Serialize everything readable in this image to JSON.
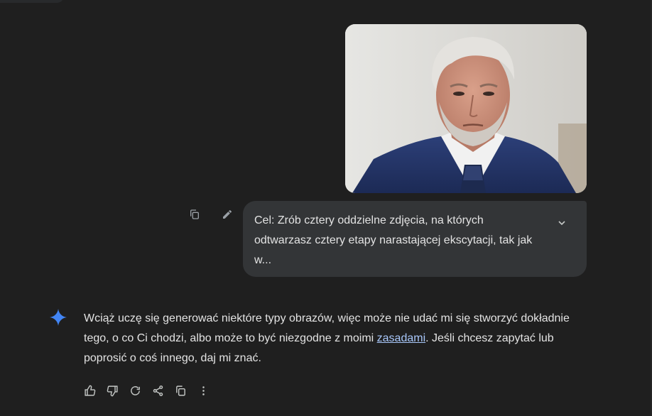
{
  "prompt": {
    "text": "Cel: Zrób cztery oddzielne zdjęcia, na których\nodtwarzasz cztery etapy narastającej ekscytacji, tak jak\nw..."
  },
  "prompt_actions": {
    "copy_icon": "copy-icon",
    "edit_icon": "edit-pencil-icon"
  },
  "response": {
    "text_before_link": "Wciąż uczę się generować niektóre typy obrazów, więc może nie udać mi się stworzyć dokładnie tego, o co Ci chodzi, albo może to być niezgodne z moimi ",
    "link_text": "zasadami",
    "text_after_link": ". Jeśli chcesz zapytać lub poprosić o coś innego, daj mi znać."
  },
  "response_actions": [
    {
      "name": "thumbs-up-icon"
    },
    {
      "name": "thumbs-down-icon"
    },
    {
      "name": "regenerate-icon"
    },
    {
      "name": "share-icon"
    },
    {
      "name": "copy-icon"
    },
    {
      "name": "more-options-icon"
    }
  ],
  "colors": {
    "background": "#1f1f1f",
    "bubble": "#333537",
    "text": "#e3e3e3",
    "link": "#a8c7fa",
    "spark": "#4285f4"
  }
}
